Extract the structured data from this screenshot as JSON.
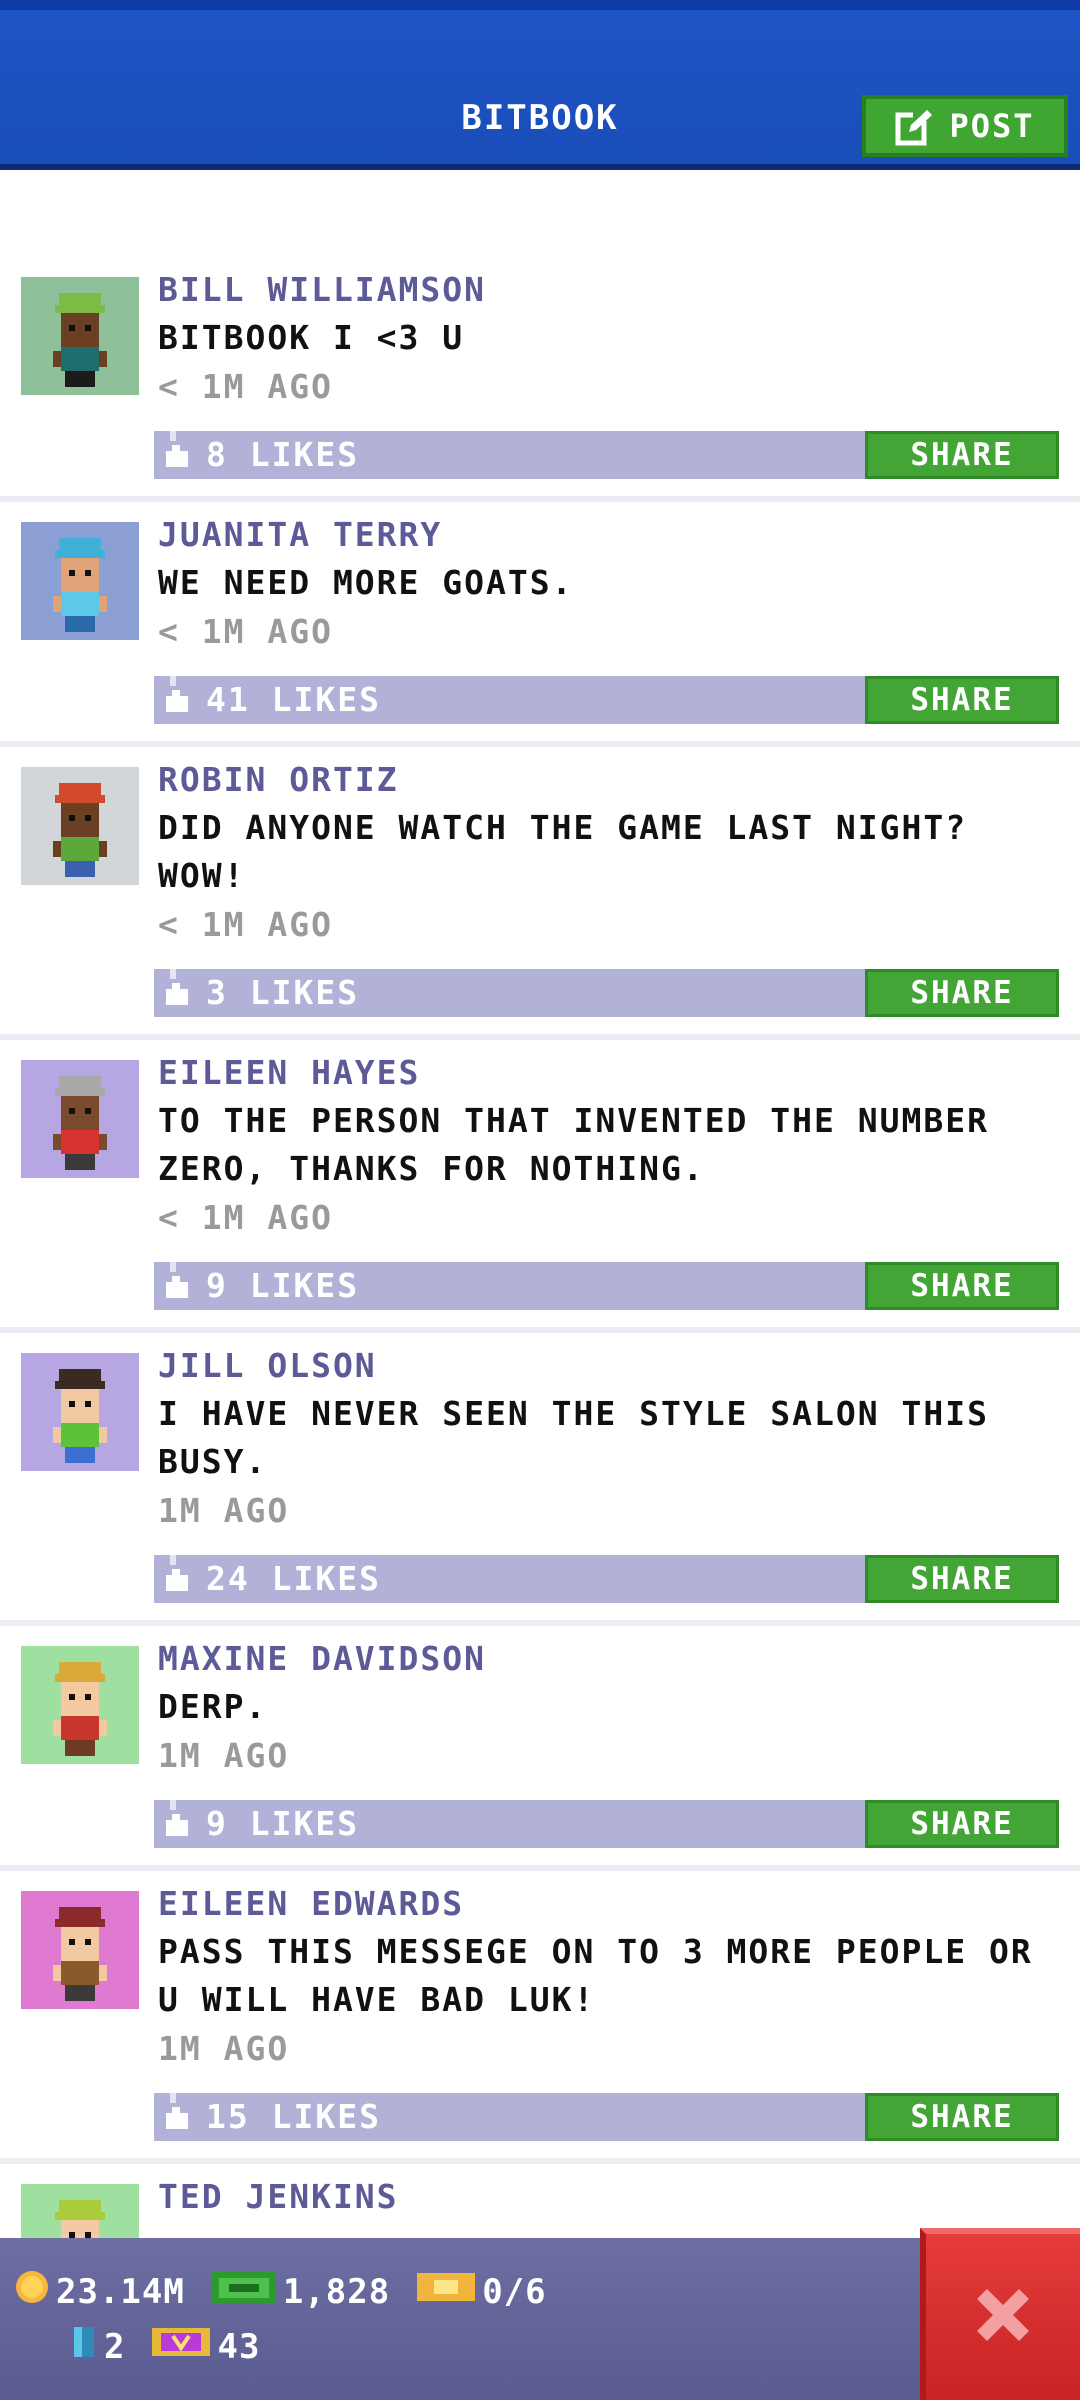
{
  "header": {
    "title": "BITBOOK",
    "post_label": "POST"
  },
  "posts": [
    {
      "name": "BILL WILLIAMSON",
      "text": "BITBOOK I <3 U",
      "time": "< 1M AGO",
      "likes": "8 LIKES",
      "share": "SHARE",
      "avatar_bg": "#8ec199",
      "skin": "#6b3f22",
      "hair": "#7cbc46",
      "shirt": "#1f6e6e",
      "pants": "#1b1b1b"
    },
    {
      "name": "JUANITA TERRY",
      "text": "WE NEED MORE GOATS.",
      "time": "< 1M AGO",
      "likes": "41 LIKES",
      "share": "SHARE",
      "avatar_bg": "#8c9fd4",
      "skin": "#e0a378",
      "hair": "#3fb0d8",
      "shirt": "#5cc9e8",
      "pants": "#2a6aa8"
    },
    {
      "name": "ROBIN ORTIZ",
      "text": "DID ANYONE WATCH THE GAME LAST NIGHT? WOW!",
      "time": "< 1M AGO",
      "likes": "3 LIKES",
      "share": "SHARE",
      "avatar_bg": "#d3d6d9",
      "skin": "#6b3f22",
      "hair": "#d24a2a",
      "shirt": "#5da83a",
      "pants": "#3b5fb0"
    },
    {
      "name": "EILEEN HAYES",
      "text": "TO THE PERSON THAT INVENTED THE NUMBER ZERO, THANKS FOR NOTHING.",
      "time": "< 1M AGO",
      "likes": "9 LIKES",
      "share": "SHARE",
      "avatar_bg": "#b6a6e2",
      "skin": "#7b4a2c",
      "hair": "#a8a8a8",
      "shirt": "#d8332e",
      "pants": "#3a3a3a"
    },
    {
      "name": "JILL OLSON",
      "text": "I HAVE NEVER SEEN THE STYLE SALON THIS BUSY.",
      "time": "1M AGO",
      "likes": "24 LIKES",
      "share": "SHARE",
      "avatar_bg": "#b6a6e2",
      "skin": "#f0c9a2",
      "hair": "#3a2a22",
      "shirt": "#5cc23a",
      "pants": "#3b6fd0"
    },
    {
      "name": "MAXINE DAVIDSON",
      "text": "DERP.",
      "time": "1M AGO",
      "likes": "9 LIKES",
      "share": "SHARE",
      "avatar_bg": "#9fe0a0",
      "skin": "#f2c9a0",
      "hair": "#d9a93a",
      "shirt": "#c9372c",
      "pants": "#6e3b22"
    },
    {
      "name": "EILEEN EDWARDS",
      "text": "PASS THIS MESSEGE ON TO 3 MORE PEOPLE OR U WILL HAVE BAD LUK!",
      "time": "1M AGO",
      "likes": "15 LIKES",
      "share": "SHARE",
      "avatar_bg": "#df7ad0",
      "skin": "#f2c9a0",
      "hair": "#8a2a2a",
      "shirt": "#8a5a2a",
      "pants": "#3a3a3a"
    },
    {
      "name": "TED JENKINS",
      "text": "",
      "time": "",
      "likes": "",
      "share": "",
      "avatar_bg": "#9fe0a0",
      "skin": "#f2c9a0",
      "hair": "#a8cc3a",
      "shirt": "#3a8a3a",
      "pants": "#2a2a2a"
    }
  ],
  "hud": {
    "coins": "23.14M",
    "bux": "1,828",
    "tickets": "0/6",
    "items": "2",
    "vip": "43"
  },
  "colors": {
    "header_blue": "#1a4db8",
    "share_green": "#43a536",
    "likes_bar": "#b2b2d8",
    "name_purple": "#5d5a98",
    "close_red": "#d42c2c"
  }
}
